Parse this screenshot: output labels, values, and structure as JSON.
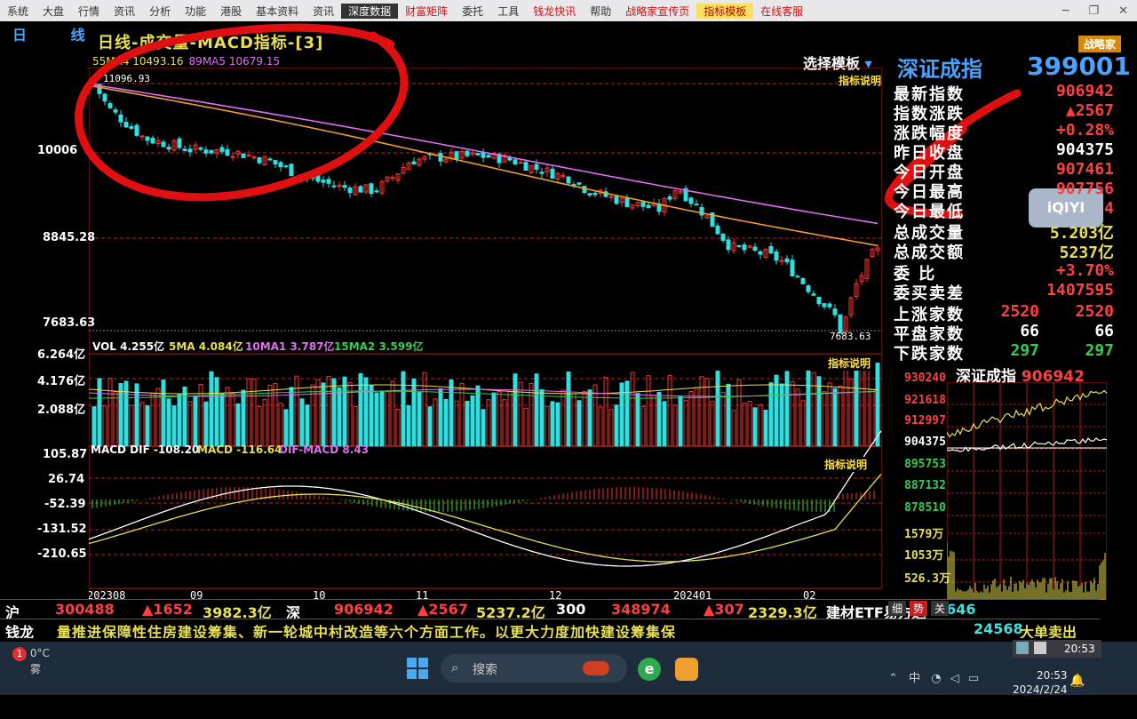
{
  "menu": {
    "items": [
      "系统",
      "大盘",
      "行情",
      "资讯",
      "分析",
      "功能",
      "港股",
      "基本资料",
      "资讯",
      "深度数据",
      "财富矩阵",
      "委托",
      "工具",
      "钱龙快讯",
      "帮助",
      "战略家宣传页",
      "指标模板",
      "在线客服"
    ],
    "brand": "战略家"
  },
  "chart": {
    "period": "日 线",
    "title": "日线-成交量-MACD指标-[3]",
    "ma_labels": [
      {
        "text": "55MA4 10493.16",
        "color": "#e8e050"
      },
      {
        "text": "89MA5 10679.15",
        "color": "#e070f0"
      }
    ],
    "select_template": "选择模板",
    "indicator_note": "指标说明",
    "price_labels": [
      "10006",
      "8845.28",
      "7683.63"
    ],
    "high_label": "11096.93",
    "low_label": "7683.63",
    "vol_header": [
      {
        "text": "VOL 4.255亿",
        "color": "#ffffff"
      },
      {
        "text": "5MA 4.084亿",
        "color": "#e8e050"
      },
      {
        "text": "10MA1 3.787亿",
        "color": "#e070f0"
      },
      {
        "text": "15MA2 3.599亿",
        "color": "#30d050"
      }
    ],
    "vol_labels": [
      "6.264亿",
      "4.176亿",
      "2.088亿"
    ],
    "macd_header": [
      {
        "text": "MACD DIF -108.20",
        "color": "#ffffff"
      },
      {
        "text": "MACD -116.64",
        "color": "#e8e050"
      },
      {
        "text": "DIF-MACD 8.43",
        "color": "#e070f0"
      }
    ],
    "macd_labels": [
      "105.87",
      "26.74",
      "-52.39",
      "-131.52",
      "-210.65"
    ],
    "date_labels": [
      "202308",
      "09",
      "10",
      "11",
      "12",
      "202401",
      "02"
    ]
  },
  "chart_data": {
    "type": "candlestick",
    "title": "日线-成交量-MACD指标-[3]",
    "x_ticks": [
      "202308",
      "09",
      "10",
      "11",
      "12",
      "202401",
      "02"
    ],
    "price_range": [
      7683.63,
      11096.93
    ],
    "high": 11096.93,
    "low": 7683.63,
    "series": [
      {
        "name": "55MA4",
        "last": 10493.16
      },
      {
        "name": "89MA5",
        "last": 10679.15
      }
    ],
    "volume": {
      "VOL": "4.255亿",
      "5MA": "4.084亿",
      "10MA1": "3.787亿",
      "15MA2": "3.599亿"
    },
    "macd": {
      "DIF": -108.2,
      "MACD": -116.64,
      "DIF-MACD": 8.43
    }
  },
  "right_panel": {
    "name": "深证成指",
    "code": "399001",
    "rows": [
      {
        "k": "最新指数",
        "v": "906942"
      },
      {
        "k": "指数涨跌",
        "v": "▲2567"
      },
      {
        "k": "涨跌幅度",
        "v": "+0.28%"
      },
      {
        "k": "昨日收盘",
        "v": "904375"
      },
      {
        "k": "今日开盘",
        "v": "907461"
      },
      {
        "k": "今日最高",
        "v": "907756"
      },
      {
        "k": "今日最低",
        "v": "4"
      },
      {
        "k": "总成交量",
        "v": "5.203亿"
      },
      {
        "k": "总成交额",
        "v": "5237亿"
      },
      {
        "k": "委 比",
        "v": "+3.70%"
      },
      {
        "k": "委买卖差",
        "v": "1407595"
      },
      {
        "k": "上涨家数",
        "v": "2520",
        "v2": "2520"
      },
      {
        "k": "平盘家数",
        "v": "66",
        "v2": "66"
      },
      {
        "k": "下跌家数",
        "v": "297",
        "v2": "297"
      }
    ],
    "mini_title": "深证成指",
    "mini_value": "906942",
    "mini_labels": [
      {
        "t": "930240",
        "c": "#ff4040"
      },
      {
        "t": "921618",
        "c": "#ff4040"
      },
      {
        "t": "912997",
        "c": "#ff4040"
      },
      {
        "t": "904375",
        "c": "#ffffff"
      },
      {
        "t": "895753",
        "c": "#30d050"
      },
      {
        "t": "887132",
        "c": "#30d050"
      },
      {
        "t": "878510",
        "c": "#30d050"
      },
      {
        "t": "1579万",
        "c": "#e8e050"
      },
      {
        "t": "1053万",
        "c": "#e8e050"
      },
      {
        "t": "526.3万",
        "c": "#e8e050"
      }
    ],
    "tabs": [
      "细",
      "势",
      "关"
    ],
    "overlay": "iQIYI"
  },
  "ticker": {
    "sh_label": "沪",
    "sh_val": "300488",
    "sh_chg": "▲1652",
    "sh_amt": "3982.3亿",
    "sz_label": "深",
    "sz_val": "906942",
    "sz_chg": "▲2567",
    "sz_amt": "5237.2亿",
    "c300_label": "300",
    "c300_val": "348974",
    "c300_chg": "▲307",
    "c300_amt": "2329.3亿",
    "etf": "建材ETF易方达",
    "etf_val": "0646",
    "etf_amt": "24568"
  },
  "news": {
    "label": "钱龙",
    "text": "量推进保障性住房建设筹集、新一轮城中村改造等六个方面工作。以更大力度加快建设筹集保",
    "big_order": "大单卖出"
  },
  "tray_time": "20:53",
  "taskbar": {
    "weather_badge": "1",
    "weather_temp": "0°C",
    "weather_desc": "雾",
    "search_placeholder": "搜索",
    "time": "20:53",
    "date": "2024/2/24"
  }
}
